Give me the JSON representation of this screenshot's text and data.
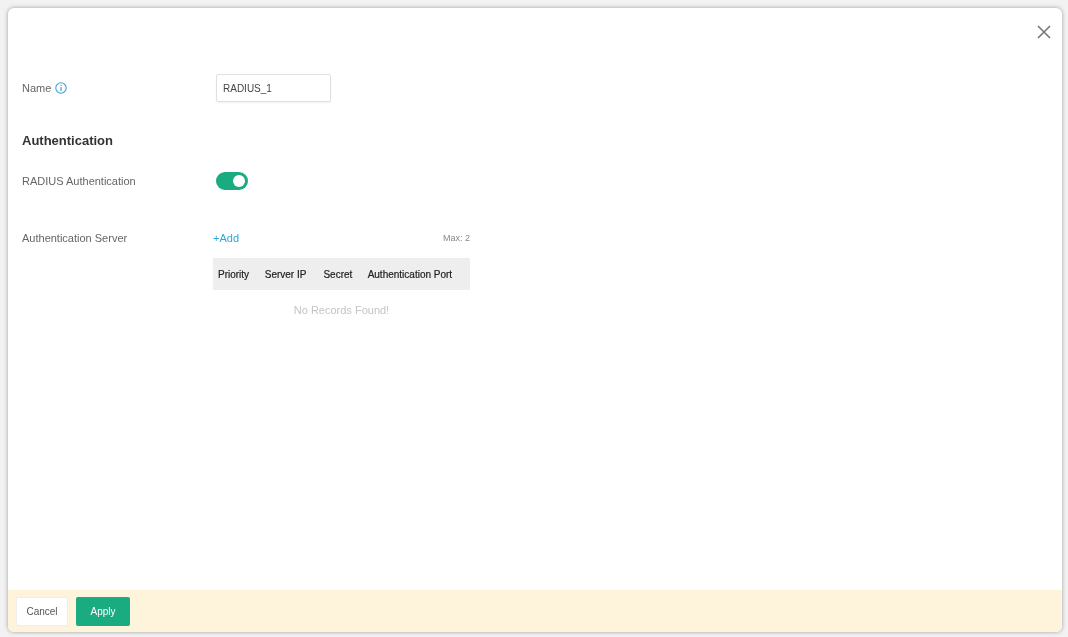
{
  "name_field": {
    "label": "Name",
    "value": "RADIUS_1"
  },
  "section_title": "Authentication",
  "radius_authentication": {
    "label": "RADIUS Authentication",
    "on": true
  },
  "authentication_server": {
    "label": "Authentication Server",
    "add_link": "+Add",
    "limit": "Max: 2",
    "table": {
      "columns": [
        "Priority",
        "Server IP",
        "Secret",
        "Authentication Port"
      ],
      "empty_message": "No Records Found!"
    }
  },
  "footer": {
    "buttons": [
      {
        "label": "Cancel",
        "kind": "secondary"
      },
      {
        "label": "Apply",
        "kind": "primary"
      }
    ]
  }
}
